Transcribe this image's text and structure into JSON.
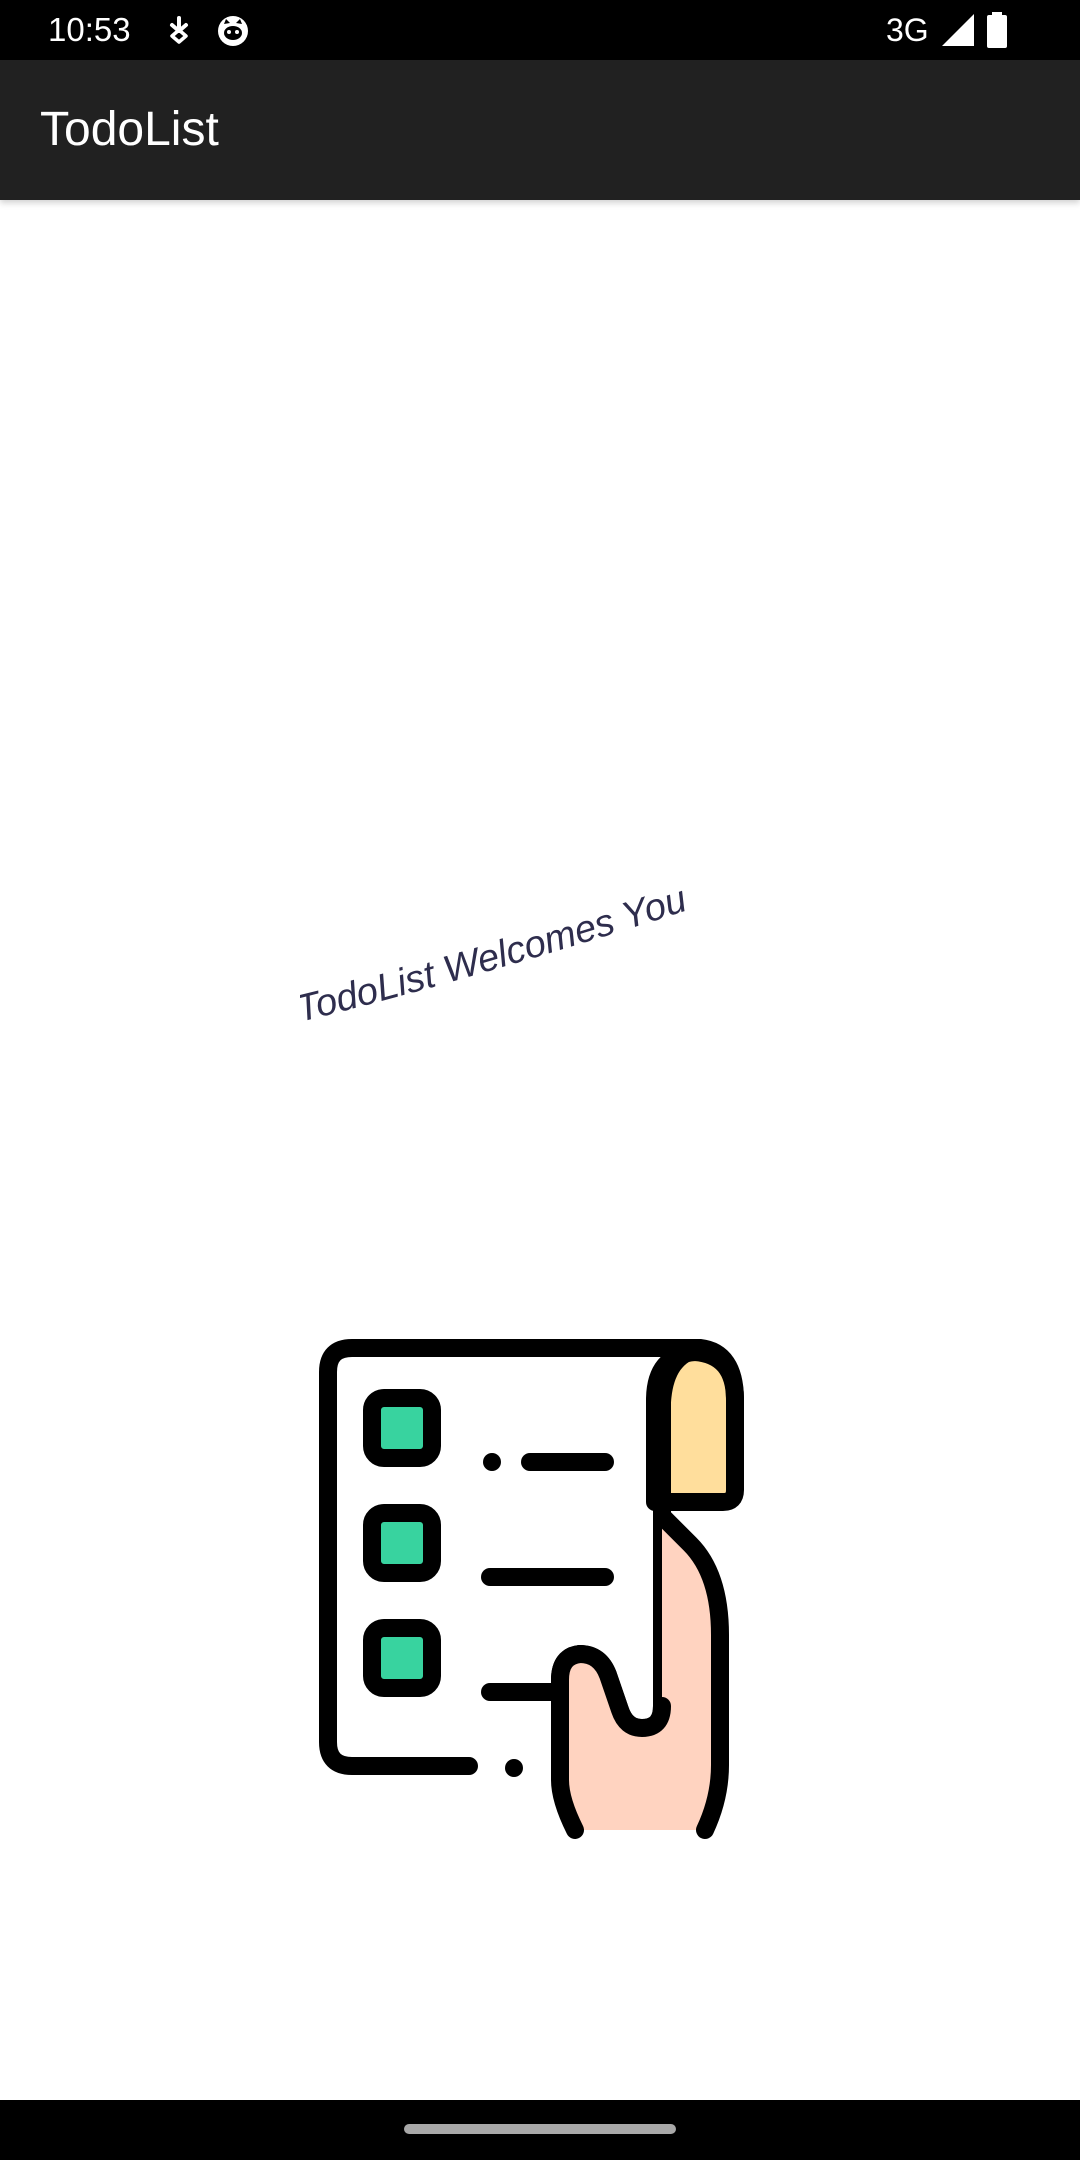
{
  "status_bar": {
    "time": "10:53",
    "network": "3G",
    "icons": [
      "download-notification-icon",
      "cat-face-notification-icon",
      "signal-icon",
      "battery-icon"
    ]
  },
  "app_bar": {
    "title": "TodoList"
  },
  "main": {
    "welcome_text": "TodoList Welcomes You",
    "illustration": "checklist-in-hand-icon"
  },
  "colors": {
    "status_bar_bg": "#000000",
    "app_bar_bg": "#212121",
    "background": "#ffffff",
    "welcome_text": "#2e2d4d",
    "checkbox_fill": "#38d39f",
    "thumb_fill": "#ffde9c",
    "hand_fill": "#ffd3c0"
  }
}
